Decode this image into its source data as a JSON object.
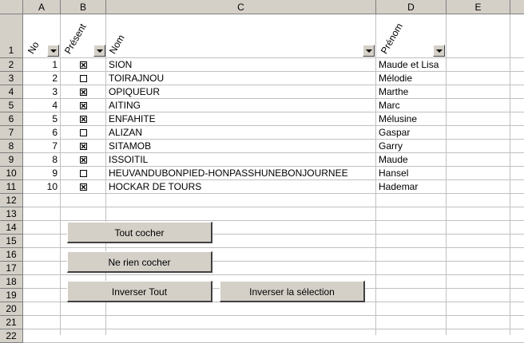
{
  "columns": [
    "A",
    "B",
    "C",
    "D",
    "E"
  ],
  "rows": [
    "1",
    "2",
    "3",
    "4",
    "5",
    "6",
    "7",
    "8",
    "9",
    "10",
    "11",
    "12",
    "13",
    "14",
    "15",
    "16",
    "17",
    "18",
    "19",
    "20",
    "21",
    "22"
  ],
  "headers": {
    "no": "No",
    "present": "Présent",
    "nom": "Nom",
    "prenom": "Prénom"
  },
  "records": [
    {
      "no": "1",
      "checked": true,
      "nom": "SION",
      "prenom": "Maude et Lisa"
    },
    {
      "no": "2",
      "checked": false,
      "nom": "TOIRAJNOU",
      "prenom": "Mélodie"
    },
    {
      "no": "3",
      "checked": true,
      "nom": "OPIQUEUR",
      "prenom": "Marthe"
    },
    {
      "no": "4",
      "checked": true,
      "nom": "AITING",
      "prenom": "Marc"
    },
    {
      "no": "5",
      "checked": true,
      "nom": "ENFAHITE",
      "prenom": "Mélusine"
    },
    {
      "no": "6",
      "checked": false,
      "nom": "ALIZAN",
      "prenom": "Gaspar"
    },
    {
      "no": "7",
      "checked": true,
      "nom": "SITAMOB",
      "prenom": "Garry"
    },
    {
      "no": "8",
      "checked": true,
      "nom": "ISSOITIL",
      "prenom": "Maude"
    },
    {
      "no": "9",
      "checked": false,
      "nom": "HEUVANDUBONPIED-HONPASSHUNEBONJOURNEE",
      "prenom": "Hansel"
    },
    {
      "no": "10",
      "checked": true,
      "nom": "HOCKAR DE TOURS",
      "prenom": "Hademar"
    }
  ],
  "buttons": {
    "tout_cocher": "Tout cocher",
    "ne_rien_cocher": "Ne rien cocher",
    "inverser_tout": "Inverser Tout",
    "inverser_selection": "Inverser la sélection"
  }
}
